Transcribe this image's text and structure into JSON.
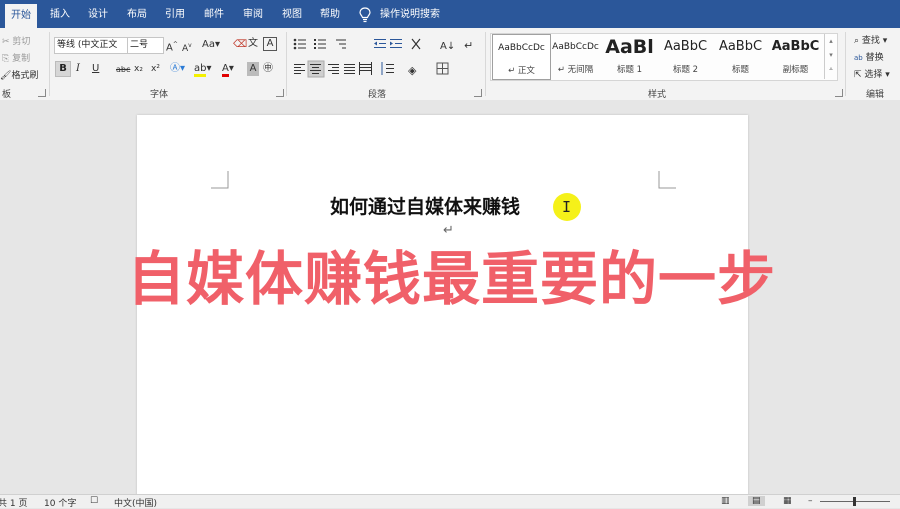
{
  "tabs": [
    "开始",
    "插入",
    "设计",
    "布局",
    "引用",
    "邮件",
    "审阅",
    "视图",
    "帮助"
  ],
  "tell_me": "操作说明搜索",
  "clipboard": {
    "cut": "剪切",
    "copy": "复制",
    "format_painter": "格式刷",
    "group": "板"
  },
  "font": {
    "name": "等线 (中文正文",
    "size": "二号",
    "group": "字体",
    "case_label": "Aa",
    "grow": "A",
    "shrink": "A",
    "bold": "B",
    "italic": "I",
    "underline": "U",
    "strike": "abc",
    "sub": "x₂",
    "sup": "x²",
    "phonetic": "文",
    "border_char": "A",
    "enclose": "㊥"
  },
  "paragraph": {
    "group": "段落"
  },
  "styles": {
    "group": "样式",
    "items": [
      {
        "preview": "AaBbCcDc",
        "label": "↵ 正文"
      },
      {
        "preview": "AaBbCcDc",
        "label": "↵ 无间隔"
      },
      {
        "preview": "AaBl",
        "label": "标题 1"
      },
      {
        "preview": "AaBbC",
        "label": "标题 2"
      },
      {
        "preview": "AaBbC",
        "label": "标题"
      },
      {
        "preview": "AaBbC",
        "label": "副标题"
      }
    ]
  },
  "editing": {
    "find": "查找",
    "replace": "替换",
    "select": "选择",
    "group": "编辑"
  },
  "document": {
    "title": "如何通过自媒体来赚钱",
    "overlay": "自媒体赚钱最重要的一步"
  },
  "status": {
    "page": "共 1 页",
    "words": "10 个字",
    "language": "中文(中国)"
  },
  "colors": {
    "accent": "#2b579a",
    "overlay_text": "#f06069",
    "highlight": "#f4f000"
  }
}
